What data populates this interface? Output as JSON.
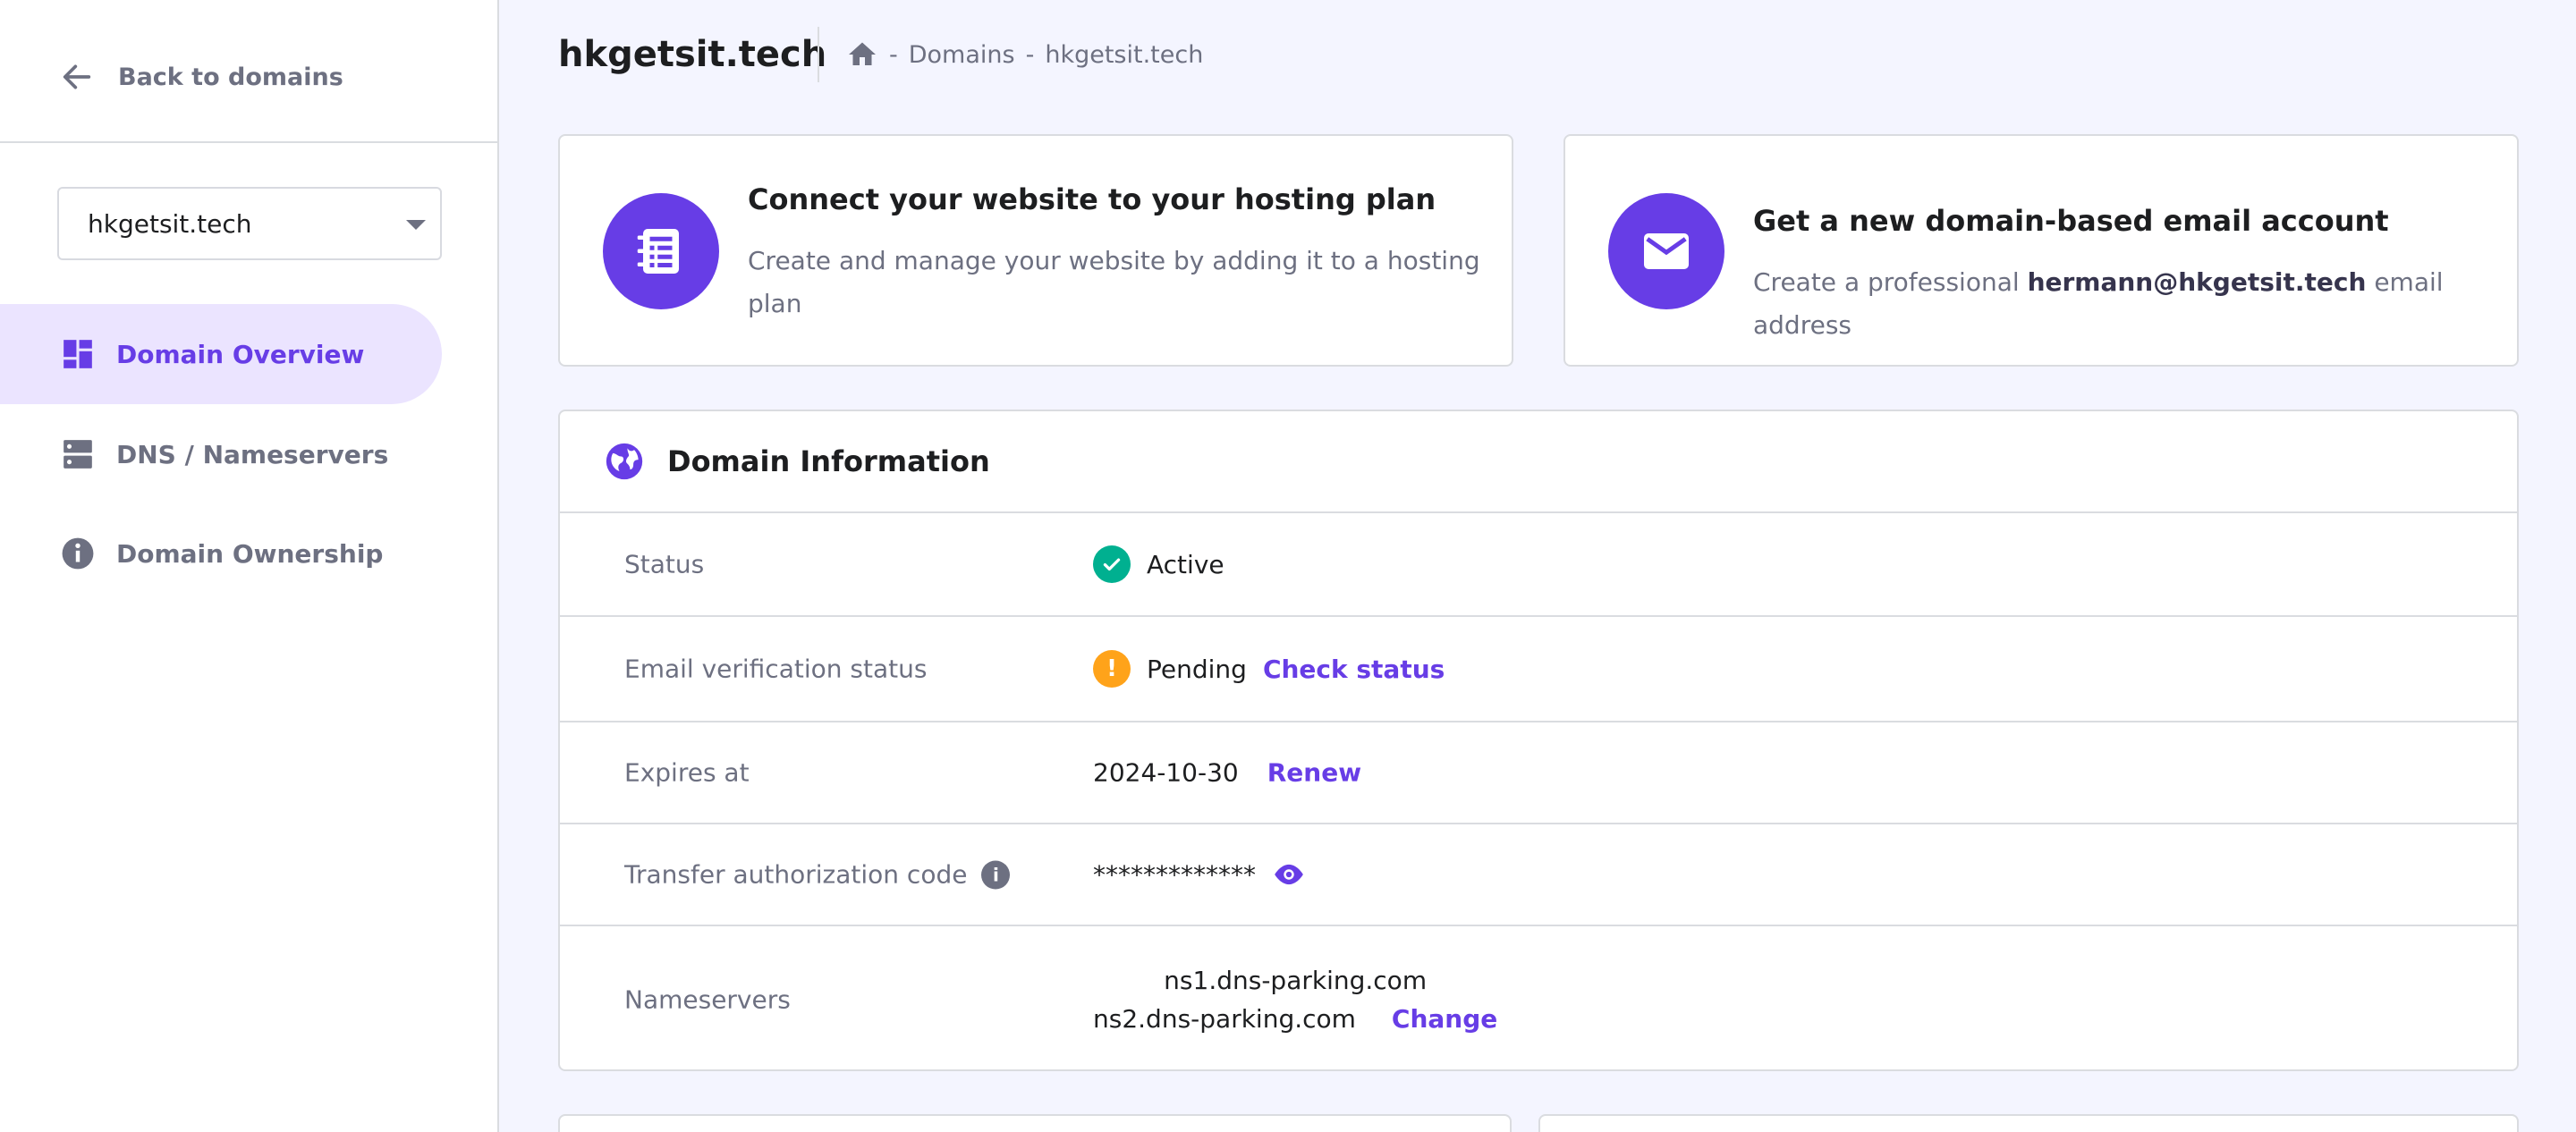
{
  "sidebar": {
    "back_label": "Back to domains",
    "domain_select": {
      "value": "hkgetsit.tech"
    },
    "items": [
      {
        "label": "Domain Overview",
        "icon": "dashboard-icon",
        "active": true
      },
      {
        "label": "DNS / Nameservers",
        "icon": "server-icon",
        "active": false
      },
      {
        "label": "Domain Ownership",
        "icon": "info-icon",
        "active": false
      }
    ]
  },
  "header": {
    "title": "hkgetsit.tech",
    "breadcrumb": [
      "Domains",
      "hkgetsit.tech"
    ],
    "breadcrumb_separator": "-"
  },
  "promos": [
    {
      "title": "Connect your website to your hosting plan",
      "description": "Create and manage your website by adding it to a hosting plan",
      "icon": "website-icon"
    },
    {
      "title": "Get a new domain-based email account",
      "description_prefix": "Create a professional",
      "description_email": "hermann@hkgetsit.tech",
      "description_suffix": "email address",
      "icon": "mail-icon"
    }
  ],
  "domain_info": {
    "title": "Domain Information",
    "rows": {
      "status": {
        "label": "Status",
        "value": "Active"
      },
      "email_verification": {
        "label": "Email verification status",
        "value": "Pending",
        "action": "Check status"
      },
      "expires": {
        "label": "Expires at",
        "value": "2024-10-30",
        "action": "Renew"
      },
      "transfer_code": {
        "label": "Transfer authorization code",
        "value": "*************"
      },
      "nameservers": {
        "label": "Nameservers",
        "ns1": "ns1.dns-parking.com",
        "ns2": "ns2.dns-parking.com",
        "action": "Change"
      }
    }
  },
  "colors": {
    "accent": "#673de6",
    "success": "#00b090",
    "warning": "#ffa31a",
    "muted": "#6d7081",
    "background": "#f4f5ff"
  }
}
